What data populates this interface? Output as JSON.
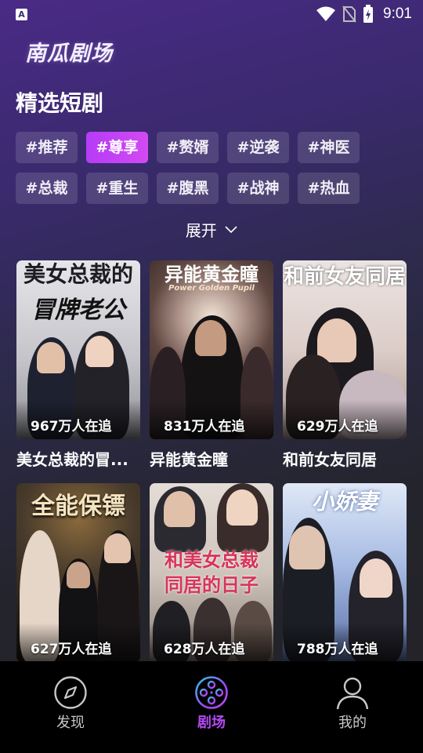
{
  "status_bar": {
    "app_icon_letter": "A",
    "time": "9:01"
  },
  "app": {
    "logo": "南瓜剧场"
  },
  "section": {
    "title": "精选短剧"
  },
  "tags": [
    {
      "label": "#推荐",
      "active": false
    },
    {
      "label": "#尊享",
      "active": true
    },
    {
      "label": "#赘婿",
      "active": false
    },
    {
      "label": "#逆袭",
      "active": false
    },
    {
      "label": "#神医",
      "active": false
    },
    {
      "label": "#总裁",
      "active": false
    },
    {
      "label": "#重生",
      "active": false
    },
    {
      "label": "#腹黑",
      "active": false
    },
    {
      "label": "#战神",
      "active": false
    },
    {
      "label": "#热血",
      "active": false
    }
  ],
  "expand_label": "展开",
  "cards": [
    {
      "title": "美女总裁的冒...",
      "heat": "967万人在追",
      "poster_text": "美女总裁的",
      "poster_text2": "冒牌老公",
      "colors": [
        "#d8d8dc",
        "#9a9aa0"
      ]
    },
    {
      "title": "异能黄金瞳",
      "heat": "831万人在追",
      "poster_text": "异能黄金瞳",
      "poster_text2": "Power Golden Pupil",
      "colors": [
        "#6a5048",
        "#2a1e1c"
      ]
    },
    {
      "title": "和前女友同居",
      "heat": "629万人在追",
      "poster_text": "和前女友同居",
      "poster_text2": "",
      "colors": [
        "#e8dfe0",
        "#b8a6a6"
      ]
    },
    {
      "title": "",
      "heat": "627万人在追",
      "poster_text": "全能保镖",
      "poster_text2": "",
      "colors": [
        "#3a3026",
        "#1c1814"
      ]
    },
    {
      "title": "",
      "heat": "628万人在追",
      "poster_text": "和美女总裁",
      "poster_text2": "同居的日子",
      "colors": [
        "#d8cfc8",
        "#8a7a70"
      ]
    },
    {
      "title": "",
      "heat": "788万人在追",
      "poster_text": "小娇妻",
      "poster_text2": "",
      "colors": [
        "#b8c8e6",
        "#7086b8"
      ]
    }
  ],
  "tab_bar": {
    "items": [
      {
        "label": "发现",
        "icon": "compass-icon",
        "active": false
      },
      {
        "label": "剧场",
        "icon": "film-reel-icon",
        "active": true
      },
      {
        "label": "我的",
        "icon": "user-icon",
        "active": false
      }
    ],
    "active_color": "#b24af2"
  }
}
